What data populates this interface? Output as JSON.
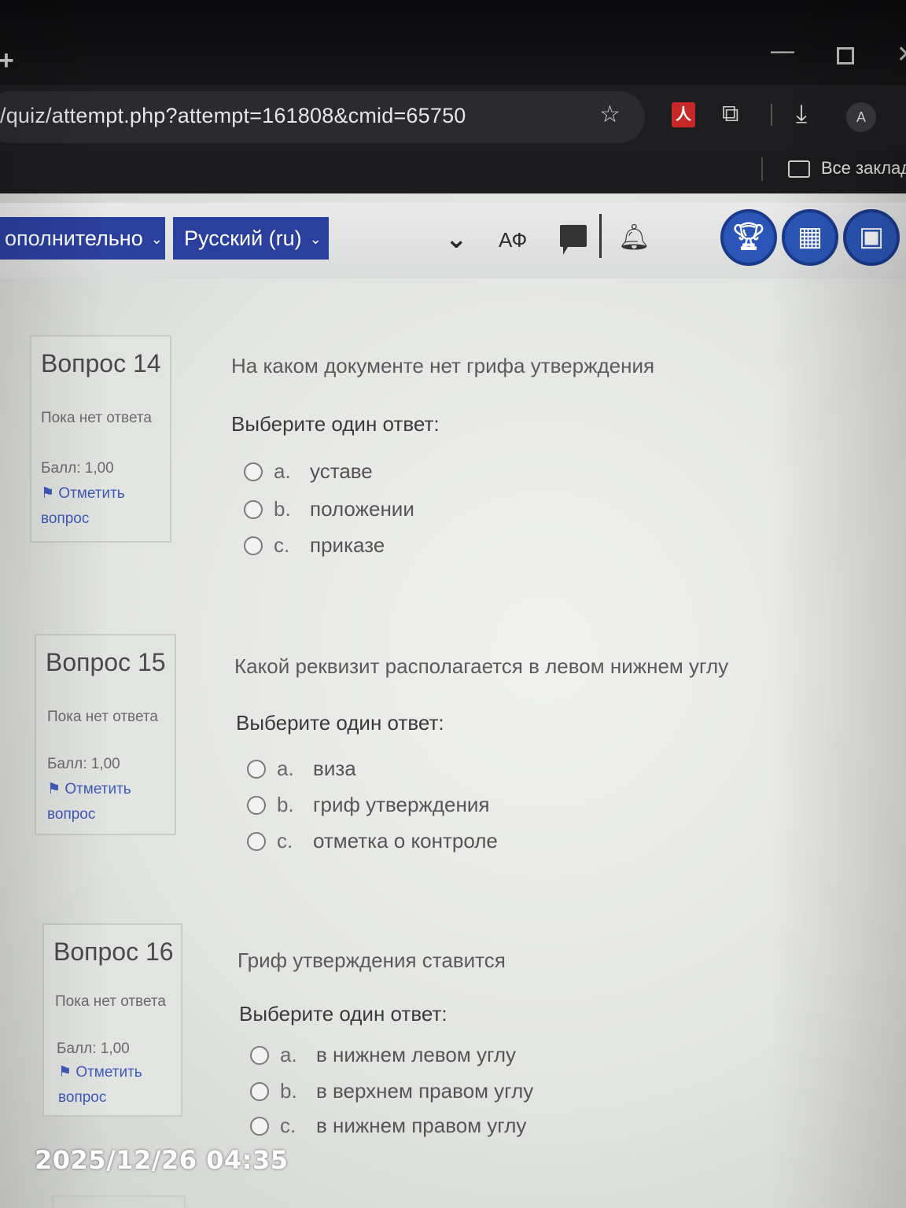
{
  "browser": {
    "url": "/quiz/attempt.php?attempt=161808&cmid=65750",
    "bookmarks_label": "Все заклад",
    "avatar_letter": "A",
    "pdf_icon_label": "人"
  },
  "navbar": {
    "more_label": "ополнительно",
    "language_label": "Русский (ru)",
    "font_toggle_label": "АФ",
    "accent_color": "#2b3f9e"
  },
  "questions": [
    {
      "number_label": "Вопрос 14",
      "status": "Пока нет ответа",
      "score": "Балл: 1,00",
      "flag_label": "Отметить вопрос",
      "text": "На каком документе нет грифа утверждения",
      "prompt": "Выберите один ответ:",
      "options": [
        {
          "letter": "a.",
          "text": "уставе"
        },
        {
          "letter": "b.",
          "text": "положении"
        },
        {
          "letter": "c.",
          "text": "приказе"
        }
      ]
    },
    {
      "number_label": "Вопрос 15",
      "status": "Пока нет ответа",
      "score": "Балл: 1,00",
      "flag_label": "Отметить вопрос",
      "text": "Какой реквизит располагается в левом нижнем углу",
      "prompt": "Выберите один ответ:",
      "options": [
        {
          "letter": "a.",
          "text": "виза"
        },
        {
          "letter": "b.",
          "text": "гриф утверждения"
        },
        {
          "letter": "c.",
          "text": "отметка о контроле"
        }
      ]
    },
    {
      "number_label": "Вопрос 16",
      "status": "Пока нет ответа",
      "score": "Балл: 1,00",
      "flag_label": "Отметить вопрос",
      "text": "Гриф утверждения ставится",
      "prompt": "Выберите один ответ:",
      "options": [
        {
          "letter": "a.",
          "text": "в нижнем левом углу"
        },
        {
          "letter": "b.",
          "text": "в верхнем правом углу"
        },
        {
          "letter": "c.",
          "text": "в нижнем правом углу"
        }
      ]
    }
  ],
  "photo_timestamp": "2025/12/26 04:35"
}
